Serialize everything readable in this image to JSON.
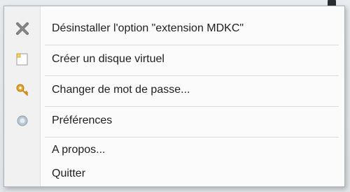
{
  "menu": {
    "items": [
      {
        "label": "Désinstaller l'option \"extension MDKC\"",
        "icon": "close-x-icon"
      },
      {
        "label": "Créer un disque virtuel",
        "icon": "new-document-icon"
      },
      {
        "label": "Changer de mot de passe...",
        "icon": "key-icon"
      },
      {
        "label": "Préférences",
        "icon": "gear-icon"
      },
      {
        "label": "A propos...",
        "icon": ""
      },
      {
        "label": "Quitter",
        "icon": ""
      }
    ]
  }
}
